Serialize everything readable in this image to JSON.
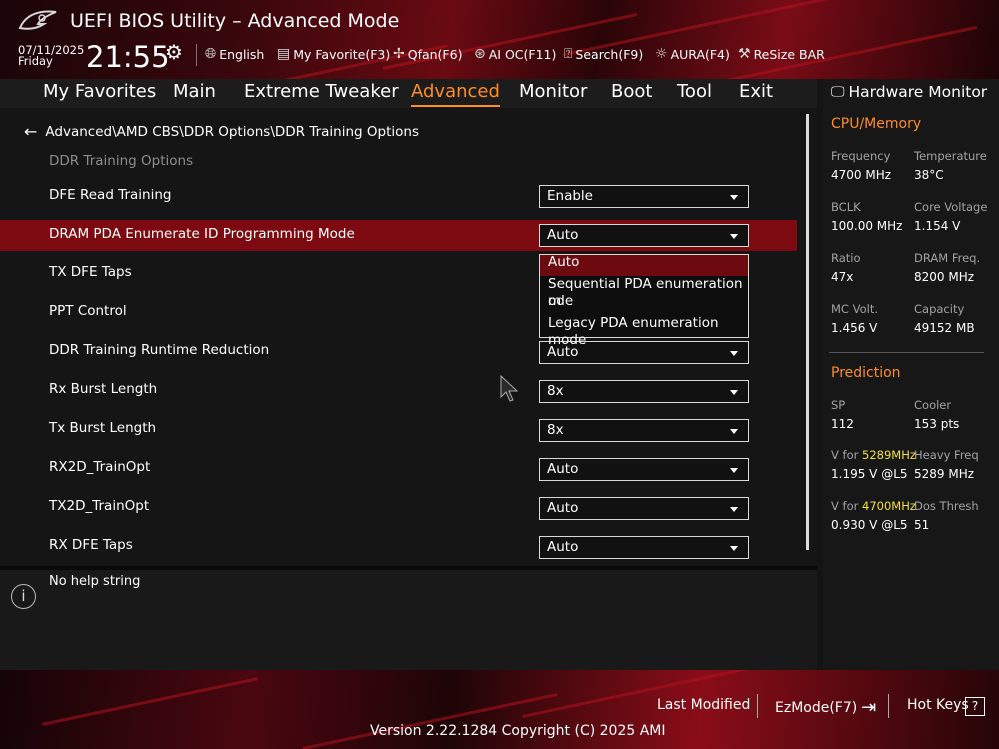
{
  "header": {
    "title": "UEFI BIOS Utility – Advanced Mode",
    "date": "07/11/2025",
    "day": "Friday",
    "time": "21:55",
    "toolbar": [
      {
        "icon": "globe-icon",
        "label": "English"
      },
      {
        "icon": "favorite-icon",
        "label": "My Favorite(F3)"
      },
      {
        "icon": "fan-icon",
        "label": "Qfan(F6)"
      },
      {
        "icon": "ai-oc-icon",
        "label": "AI OC(F11)"
      },
      {
        "icon": "search-icon",
        "label": "Search(F9)"
      },
      {
        "icon": "aura-icon",
        "label": "AURA(F4)"
      },
      {
        "icon": "resize-bar-icon",
        "label": "ReSize BAR"
      }
    ]
  },
  "menu": {
    "tabs": [
      "My Favorites",
      "Main",
      "Extreme Tweaker",
      "Advanced",
      "Monitor",
      "Boot",
      "Tool",
      "Exit"
    ],
    "active": "Advanced"
  },
  "main": {
    "breadcrumb": "Advanced\\AMD CBS\\DDR Options\\DDR Training Options",
    "section_title": "DDR Training Options",
    "rows": [
      {
        "label": "DFE Read Training",
        "value": "Enable"
      },
      {
        "label": "DRAM PDA Enumerate ID Programming Mode",
        "value": "Auto"
      },
      {
        "label": "TX DFE Taps",
        "value": ""
      },
      {
        "label": "PPT Control",
        "value": ""
      },
      {
        "label": "DDR Training Runtime Reduction",
        "value": "Auto"
      },
      {
        "label": "Rx Burst Length",
        "value": "8x"
      },
      {
        "label": "Tx Burst Length",
        "value": "8x"
      },
      {
        "label": "RX2D_TrainOpt",
        "value": "Auto"
      },
      {
        "label": "TX2D_TrainOpt",
        "value": "Auto"
      },
      {
        "label": "RX DFE Taps",
        "value": "Auto"
      }
    ],
    "open_dropdown_options": [
      "Auto",
      "Sequential PDA enumeration m",
      "ode",
      "Legacy PDA enumeration mode"
    ]
  },
  "help": {
    "text": "No help string"
  },
  "hardware_monitor": {
    "title": "Hardware Monitor",
    "cpu_memory": {
      "heading": "CPU/Memory",
      "frequency_label": "Frequency",
      "frequency": "4700 MHz",
      "temperature_label": "Temperature",
      "temperature": "38°C",
      "bclk_label": "BCLK",
      "bclk": "100.00 MHz",
      "core_voltage_label": "Core Voltage",
      "core_voltage": "1.154 V",
      "ratio_label": "Ratio",
      "ratio": "47x",
      "dram_freq_label": "DRAM Freq.",
      "dram_freq": "8200 MHz",
      "mc_volt_label": "MC Volt.",
      "mc_volt": "1.456 V",
      "capacity_label": "Capacity",
      "capacity": "49152 MB"
    },
    "prediction": {
      "heading": "Prediction",
      "sp_label": "SP",
      "sp": "112",
      "cooler_label": "Cooler",
      "cooler": "153 pts",
      "v_for_label": "V for",
      "freq1": "5289MHz",
      "v1": "1.195 V @L5",
      "heavy_freq_label": "Heavy Freq",
      "heavy_freq": "5289 MHz",
      "freq2": "4700MHz",
      "v2": "0.930 V @L5",
      "dos_thresh_label": "Dos Thresh",
      "dos_thresh": "51"
    }
  },
  "footer": {
    "last_modified": "Last Modified",
    "ezmode": "EzMode(F7)",
    "hot_keys": "Hot Keys",
    "hot_keys_icon": "?",
    "version": "Version 2.22.1284 Copyright (C) 2025 AMI"
  },
  "colors": {
    "accent": "#ff8c2a",
    "highlight_row": "#7c0a10",
    "predict_freq": "#f3e03a"
  }
}
